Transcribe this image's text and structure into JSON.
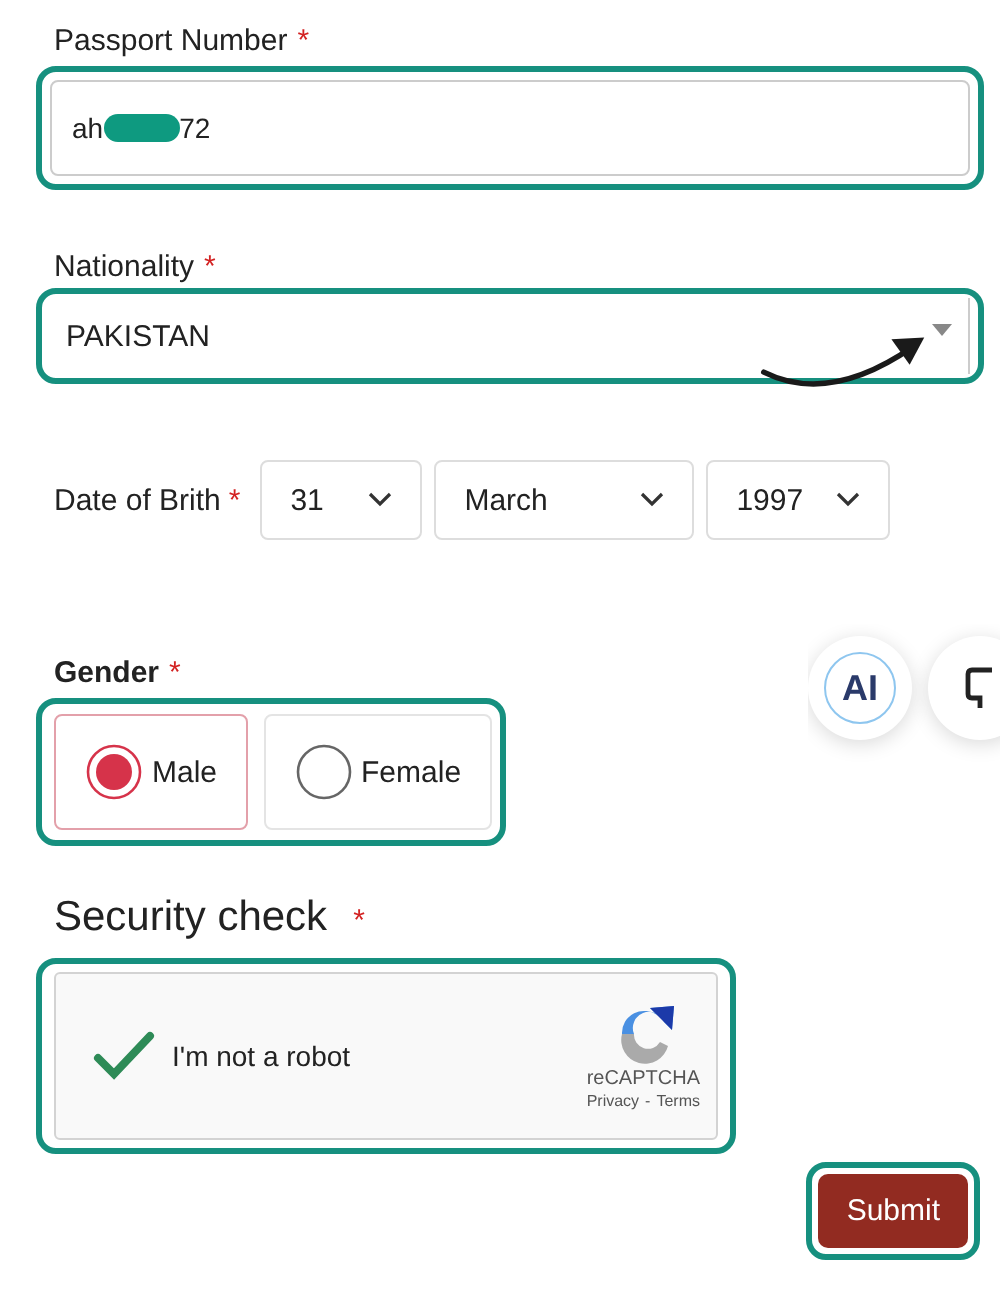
{
  "passport": {
    "label": "Passport Number",
    "required_mark": "*",
    "value_start": "ah",
    "value_end": "72",
    "redacted": true,
    "highlighted": true
  },
  "nationality": {
    "label": "Nationality",
    "required_mark": "*",
    "value": "PAKISTAN",
    "highlighted": true,
    "pointer_arrow": true
  },
  "date_of_birth": {
    "label": "Date of Brith",
    "required_mark": "*",
    "day": "31",
    "month": "March",
    "year": "1997"
  },
  "gender": {
    "label": "Gender",
    "required_mark": "*",
    "highlighted": true,
    "options": [
      {
        "label": "Male",
        "selected": true
      },
      {
        "label": "Female",
        "selected": false
      }
    ]
  },
  "floating_buttons": [
    {
      "kind": "ai",
      "label": "AI"
    },
    {
      "kind": "chat"
    }
  ],
  "security_check": {
    "label": "Security check",
    "required_mark": "*",
    "highlighted": true,
    "captcha": {
      "label": "I'm not a robot",
      "checked": true,
      "brand": "reCAPTCHA",
      "privacy": "Privacy",
      "separator": "-",
      "terms": "Terms"
    }
  },
  "submit": {
    "label": "Submit",
    "highlighted": true
  }
}
